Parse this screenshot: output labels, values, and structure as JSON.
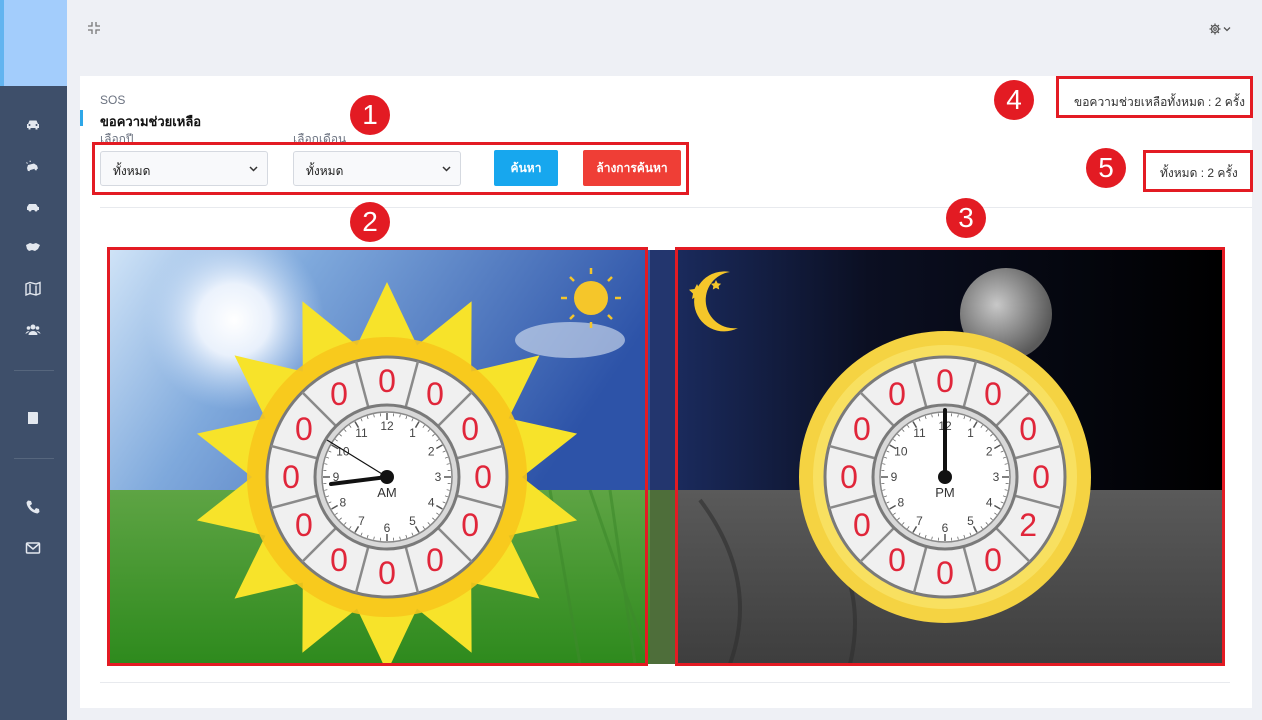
{
  "header": {
    "breadcrumb": "SOS",
    "title": "ขอความช่วยเหลือ"
  },
  "filters": {
    "year_label": "เลือกปี",
    "year_value": "ทั้งหมด",
    "month_label": "เลือกเดือน",
    "month_value": "ทั้งหมด",
    "search_label": "ค้นหา",
    "clear_label": "ล้างการค้นหา"
  },
  "stats": {
    "total_help_text": "ขอความช่วยเหลือทั้งหมด : 2 ครั้ง",
    "total_text": "ทั้งหมด : 2 ครั้ง"
  },
  "annotations": [
    "1",
    "2",
    "3",
    "4",
    "5"
  ],
  "am_clock": {
    "period": "AM",
    "ring_values": [
      "0",
      "0",
      "0",
      "0",
      "0",
      "0",
      "0",
      "0",
      "0",
      "0",
      "0",
      "0"
    ]
  },
  "pm_clock": {
    "period": "PM",
    "ring_values": [
      "0",
      "0",
      "0",
      "0",
      "2",
      "0",
      "0",
      "0",
      "0",
      "0",
      "0",
      "0"
    ]
  },
  "clock_numbers": [
    "12",
    "1",
    "2",
    "3",
    "4",
    "5",
    "6",
    "7",
    "8",
    "9",
    "10",
    "11"
  ],
  "colors": {
    "sidebar": "#3e4f6a",
    "accent_blue": "#17a7ee",
    "accent_red": "#ef3e36",
    "annotation_red": "#e31b23",
    "ring_digit": "#e0263a"
  },
  "sidebar_icons": [
    "car-icon",
    "car-crash-icon",
    "car-side-icon",
    "handshake-icon",
    "map-icon",
    "users-icon",
    "book-icon",
    "phone-icon",
    "envelope-icon"
  ]
}
